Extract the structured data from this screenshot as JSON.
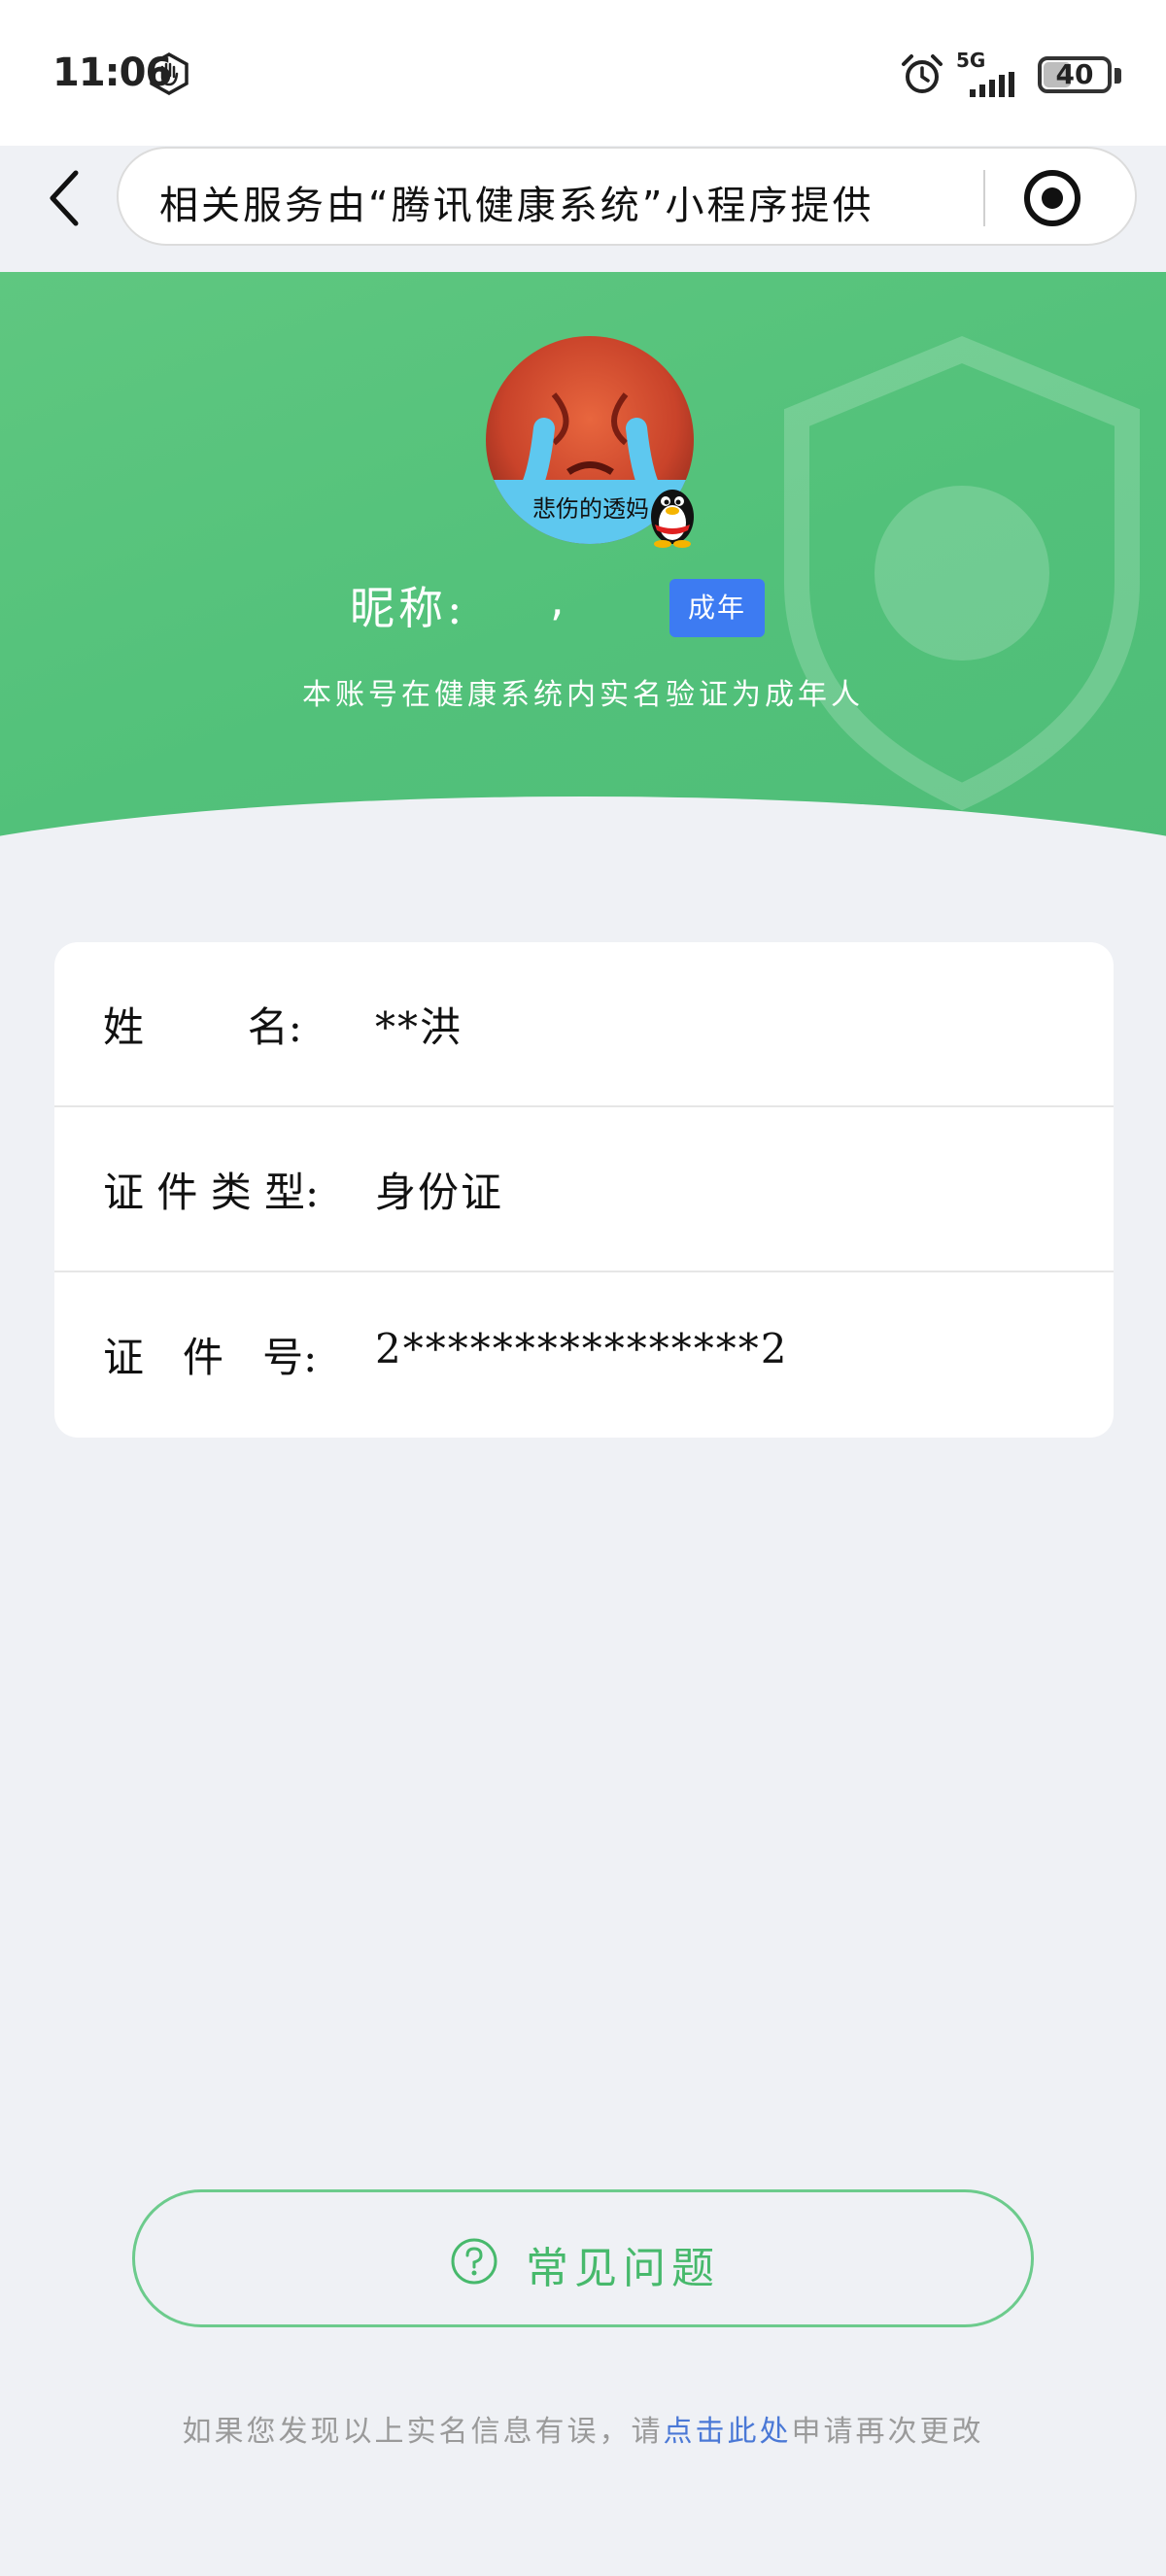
{
  "status_bar": {
    "time": "11:06",
    "network": "5G",
    "battery": "40"
  },
  "nav": {
    "title": "相关服务由“腾讯健康系统”小程序提供"
  },
  "profile": {
    "avatar_caption": "悲伤的透妈",
    "nickname_label": "昵称:",
    "nickname_value": ",",
    "badge": "成年",
    "verify_text": "本账号在健康系统内实名验证为成年人"
  },
  "info": {
    "rows": [
      {
        "label": "姓        名:",
        "value": "**洪"
      },
      {
        "label": "证 件 类 型:",
        "value": "身份证"
      },
      {
        "label": "证   件   号:",
        "value": "2****************2"
      }
    ]
  },
  "faq": {
    "label": "常见问题"
  },
  "footer": {
    "prefix": "如果您发现以上实名信息有误，请",
    "link": "点击此处",
    "suffix": "申请再次更改"
  },
  "colors": {
    "green": "#52c17a",
    "badge_blue": "#3d7bf2",
    "link_blue": "#4a78d6",
    "faq_green": "#47b96c",
    "background": "#eff1f5"
  }
}
